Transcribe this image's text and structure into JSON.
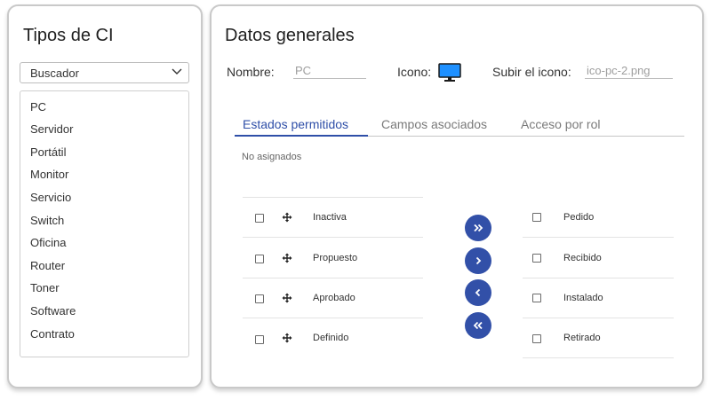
{
  "left": {
    "title": "Tipos de CI",
    "dropdown_value": "Buscador",
    "items": [
      "PC",
      "Servidor",
      "Portátil",
      "Monitor",
      "Servicio",
      "Switch",
      "Oficina",
      "Router",
      "Toner",
      "Software",
      "Contrato"
    ]
  },
  "right": {
    "title": "Datos generales",
    "nombre_label": "Nombre:",
    "nombre_value": "PC",
    "icono_label": "Icono:",
    "icon_name": "monitor-icon",
    "subir_label": "Subir el icono:",
    "subir_value": "ico-pc-2.png",
    "tabs": [
      {
        "label": "Estados permitidos",
        "active": true
      },
      {
        "label": "Campos asociados",
        "active": false
      },
      {
        "label": "Acceso por rol",
        "active": false
      }
    ],
    "no_asignados": "No asignados",
    "left_states": [
      "Inactiva",
      "Propuesto",
      "Aprobado",
      "Definido"
    ],
    "right_states": [
      "Pedido",
      "Recibido",
      "Instalado",
      "Retirado"
    ]
  },
  "colors": {
    "accent": "#3250a8",
    "tab_active": "#2f4fa8",
    "monitor_screen": "#1e90ff"
  }
}
